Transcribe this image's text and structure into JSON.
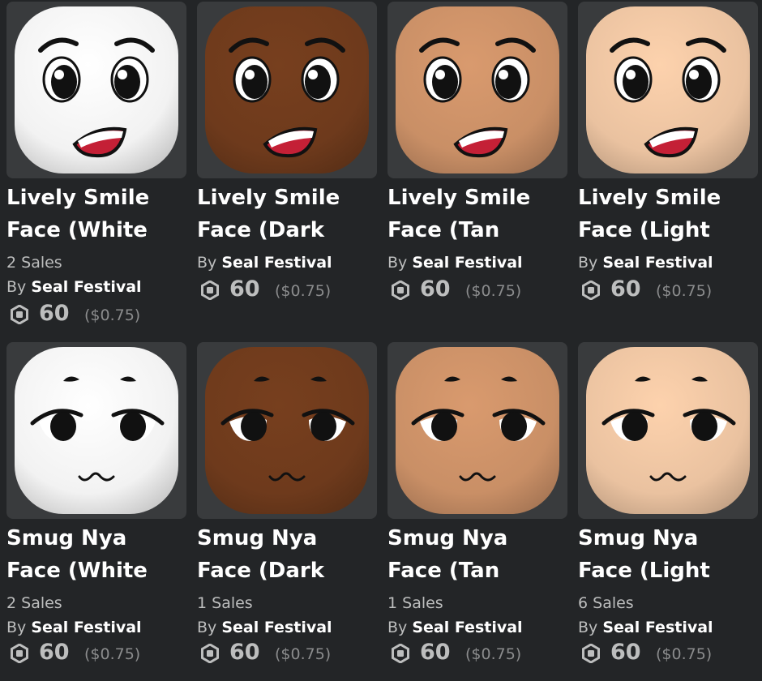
{
  "items": [
    {
      "name": "Lively Smile\nFace (White",
      "sales": "2 Sales",
      "by": "By",
      "creator": "Seal Festival",
      "price": "60",
      "usd": "($0.75)",
      "skin": "#f2f2f2",
      "face": "lively"
    },
    {
      "name": "Lively Smile\nFace (Dark",
      "sales": "",
      "by": "By",
      "creator": "Seal Festival",
      "price": "60",
      "usd": "($0.75)",
      "skin": "#6e3a1c",
      "face": "lively"
    },
    {
      "name": "Lively Smile\nFace (Tan",
      "sales": "",
      "by": "By",
      "creator": "Seal Festival",
      "price": "60",
      "usd": "($0.75)",
      "skin": "#c98f66",
      "face": "lively"
    },
    {
      "name": "Lively Smile\nFace (Light",
      "sales": "",
      "by": "By",
      "creator": "Seal Festival",
      "price": "60",
      "usd": "($0.75)",
      "skin": "#eac2a0",
      "face": "lively"
    },
    {
      "name": "Smug Nya\nFace (White",
      "sales": "2 Sales",
      "by": "By",
      "creator": "Seal Festival",
      "price": "60",
      "usd": "($0.75)",
      "skin": "#f2f2f2",
      "face": "smug"
    },
    {
      "name": "Smug Nya\nFace (Dark",
      "sales": "1 Sales",
      "by": "By",
      "creator": "Seal Festival",
      "price": "60",
      "usd": "($0.75)",
      "skin": "#6e3a1c",
      "face": "smug"
    },
    {
      "name": "Smug Nya\nFace (Tan",
      "sales": "1 Sales",
      "by": "By",
      "creator": "Seal Festival",
      "price": "60",
      "usd": "($0.75)",
      "skin": "#c98f66",
      "face": "smug"
    },
    {
      "name": "Smug Nya\nFace (Light",
      "sales": "6 Sales",
      "by": "By",
      "creator": "Seal Festival",
      "price": "60",
      "usd": "($0.75)",
      "skin": "#eac2a0",
      "face": "smug"
    }
  ]
}
